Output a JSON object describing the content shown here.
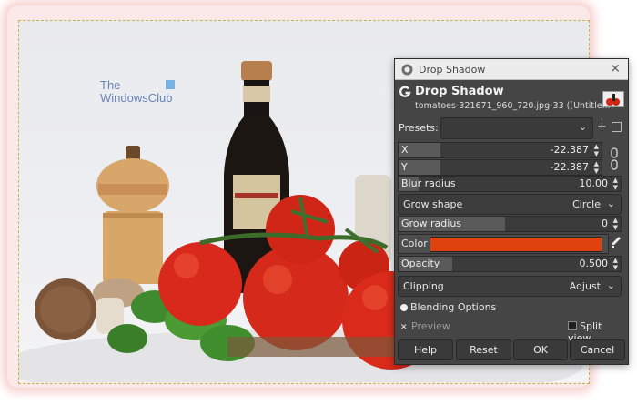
{
  "watermark": {
    "line1": "The",
    "line2": "WindowsClub"
  },
  "dialog": {
    "window_title": "Drop Shadow",
    "header_title": "Drop Shadow",
    "header_subtitle": "tomatoes-321671_960_720.jpg-33 ([Untitle...",
    "presets_label": "Presets:",
    "presets_value": "",
    "x": {
      "label": "X",
      "value": "-22.387"
    },
    "y": {
      "label": "Y",
      "value": "-22.387"
    },
    "blur_radius": {
      "label": "Blur radius",
      "value": "10.00"
    },
    "grow_shape": {
      "label": "Grow shape",
      "value": "Circle"
    },
    "grow_radius": {
      "label": "Grow radius",
      "value": "0"
    },
    "color": {
      "label": "Color",
      "value": "#e0420f"
    },
    "opacity": {
      "label": "Opacity",
      "value": "0.500"
    },
    "clipping": {
      "label": "Clipping",
      "value": "Adjust"
    },
    "blending_options": "Blending Options",
    "preview": "Preview",
    "split_view": "Split view",
    "buttons": {
      "help": "Help",
      "reset": "Reset",
      "ok": "OK",
      "cancel": "Cancel"
    }
  },
  "colors": {
    "dialog_bg": "#454545",
    "shadow_color": "#e0420f",
    "selection_border": "#c8b44a"
  }
}
